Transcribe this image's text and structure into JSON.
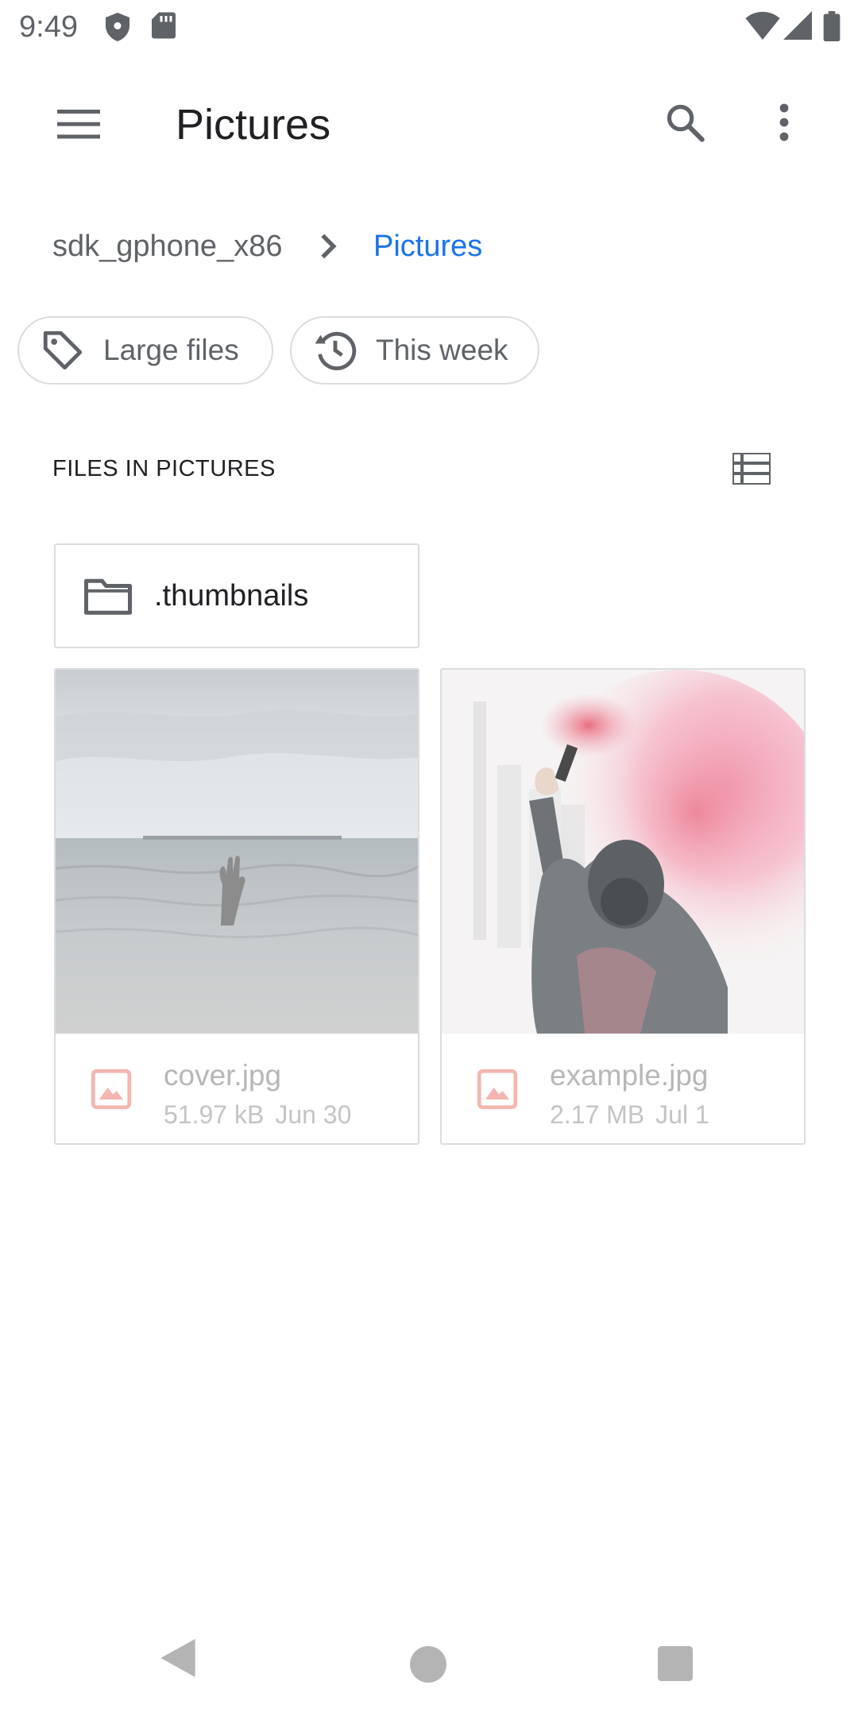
{
  "status_bar": {
    "time": "9:49",
    "icons": [
      "shield-icon",
      "sd-card-icon",
      "wifi-icon",
      "signal-icon",
      "battery-icon"
    ]
  },
  "toolbar": {
    "title": "Pictures",
    "icons": [
      "menu-icon",
      "search-icon",
      "more-vert-icon"
    ]
  },
  "breadcrumb": {
    "root": "sdk_gphone_x86",
    "current": "Pictures",
    "separator_icon": "chevron-right-icon",
    "current_color": "#1a73e8"
  },
  "chips": [
    {
      "label": "Large files",
      "icon": "tag-icon"
    },
    {
      "label": "This week",
      "icon": "history-icon"
    }
  ],
  "section": {
    "title": "FILES IN PICTURES",
    "view_toggle_icon": "list-view-icon"
  },
  "folders": [
    {
      "name": ".thumbnails",
      "icon": "folder-icon"
    }
  ],
  "files": [
    {
      "name": "cover.jpg",
      "size": "51.97 kB",
      "date": "Jun 30",
      "icon": "image-file-icon"
    },
    {
      "name": "example.jpg",
      "size": "2.17 MB",
      "date": "Jul 1",
      "icon": "image-file-icon"
    }
  ],
  "nav_bar": {
    "icons": [
      "back-icon",
      "home-icon",
      "recents-icon"
    ]
  }
}
